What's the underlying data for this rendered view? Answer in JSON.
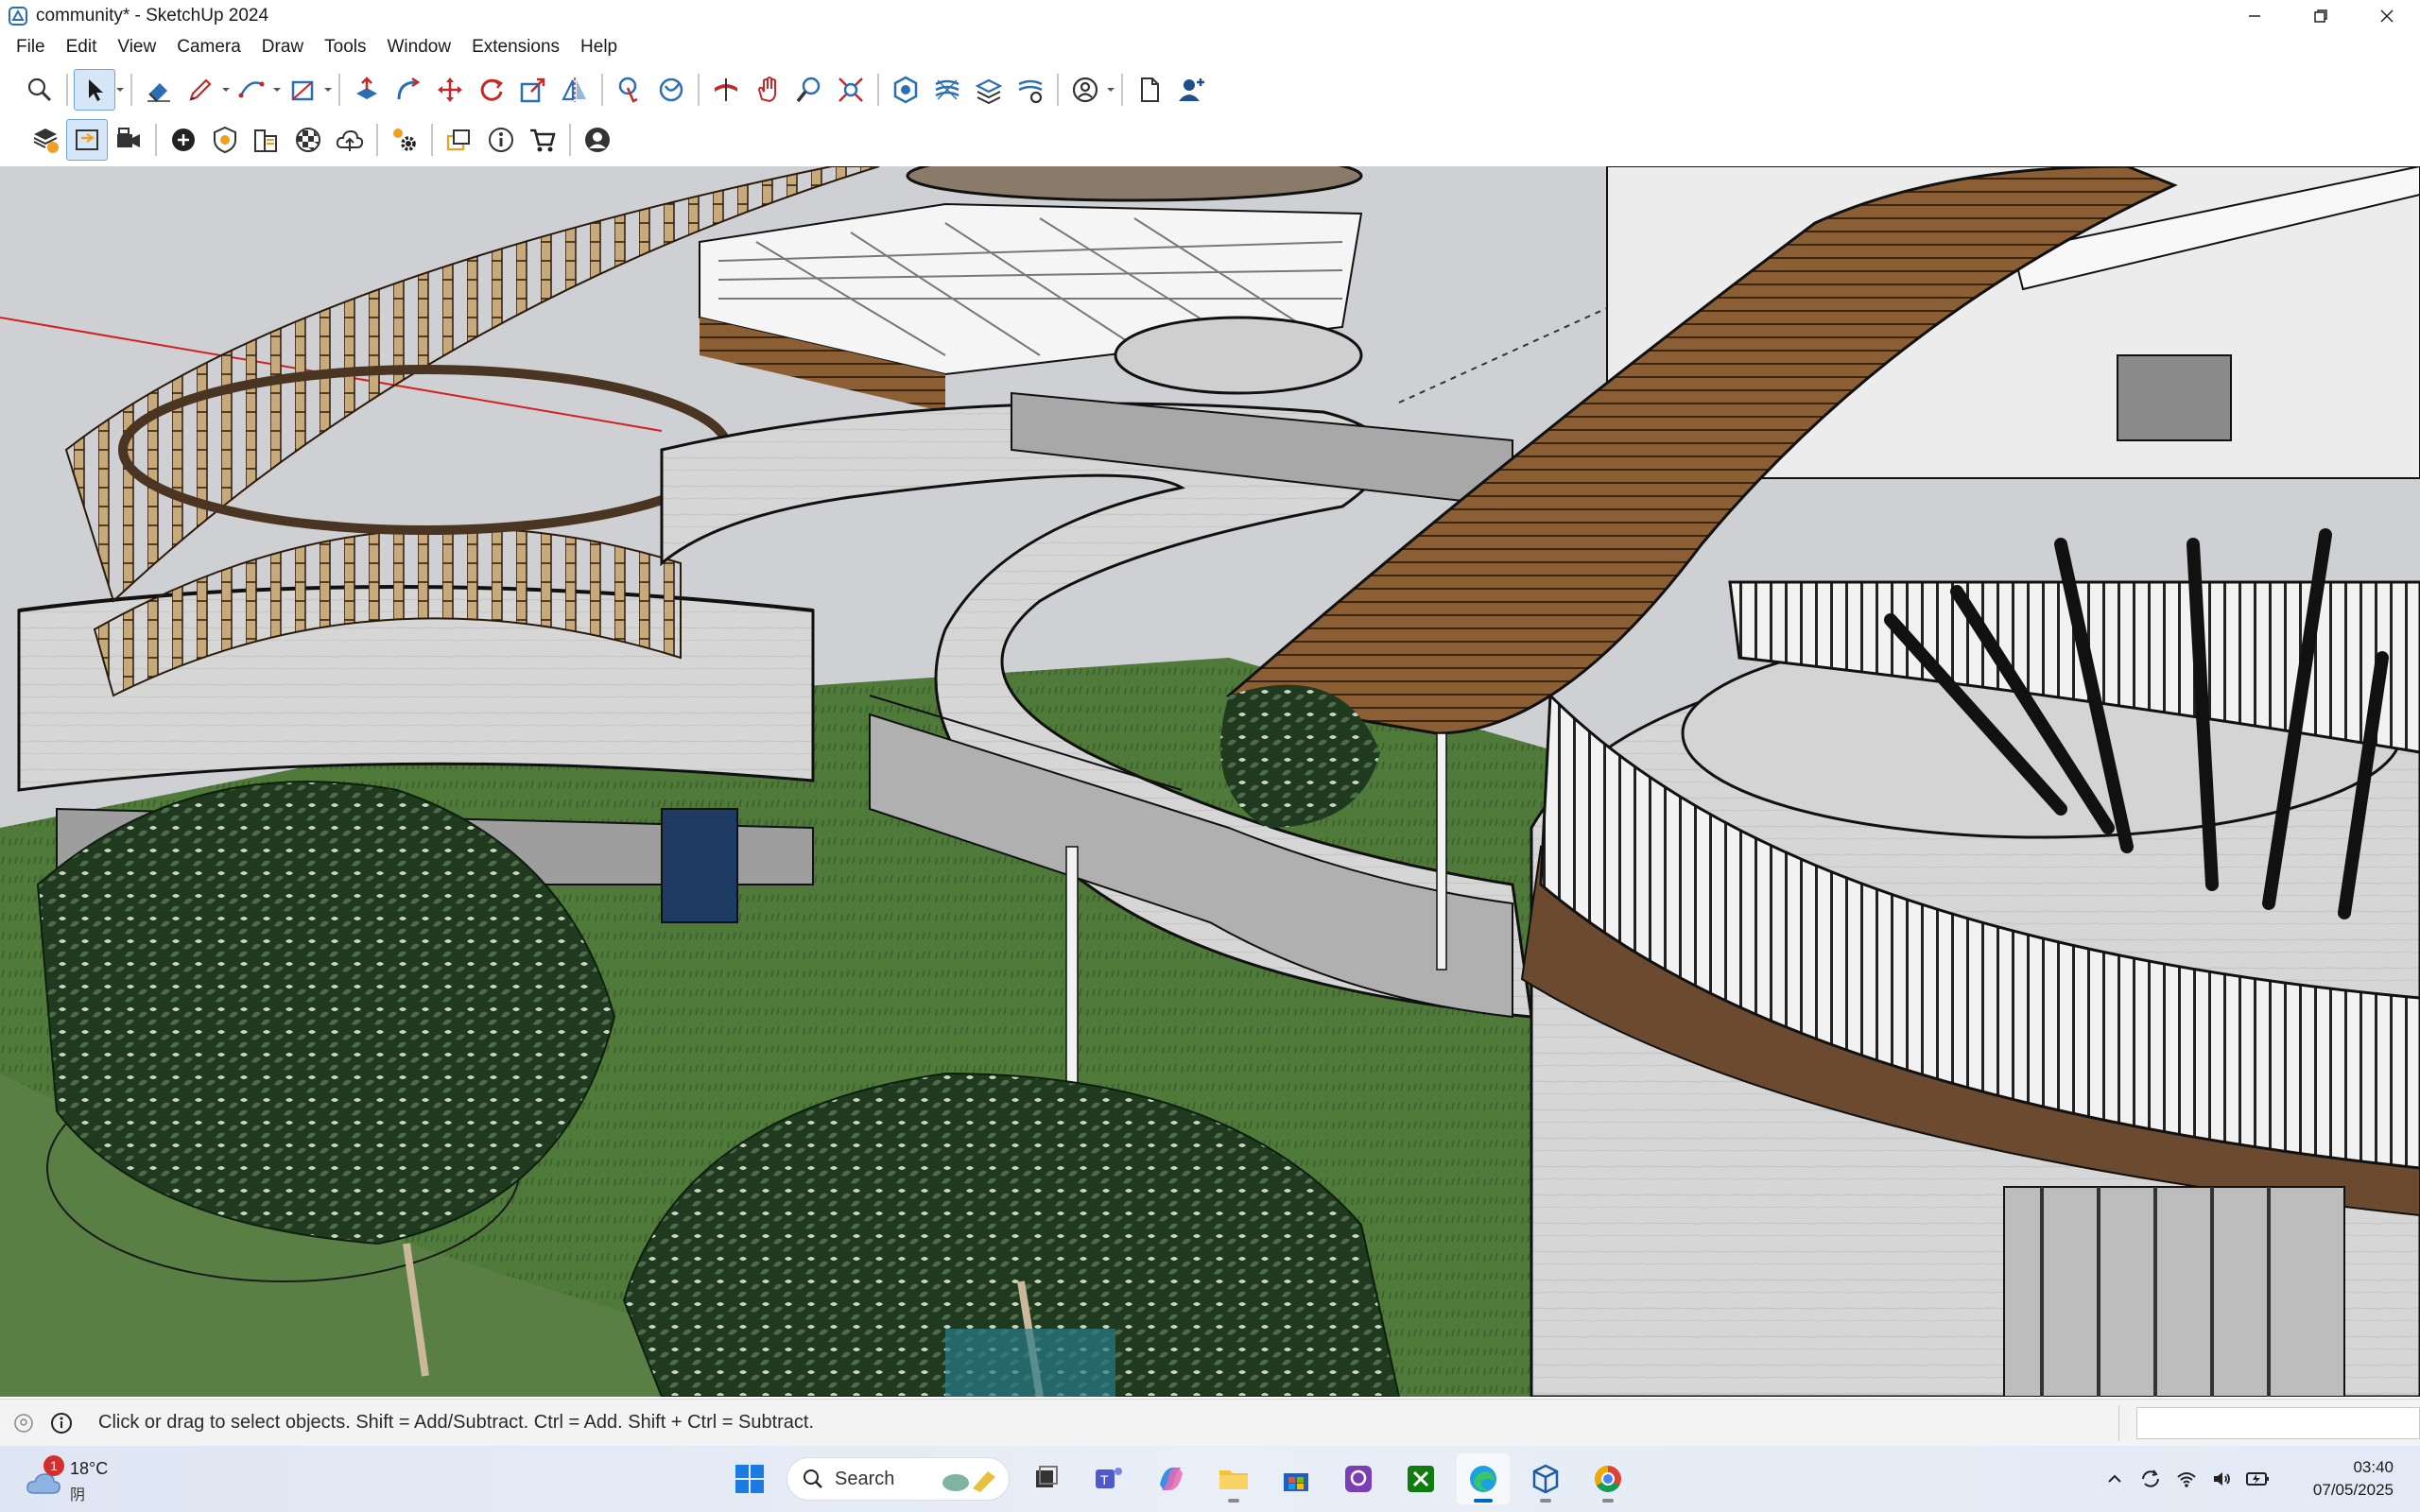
{
  "window": {
    "title": "community* - SketchUp 2024",
    "app_icon": "sketchup-icon",
    "controls": [
      "minimize-icon",
      "restore-icon",
      "close-icon"
    ]
  },
  "menu": {
    "items": [
      "File",
      "Edit",
      "View",
      "Camera",
      "Draw",
      "Tools",
      "Window",
      "Extensions",
      "Help"
    ]
  },
  "toolbar1": {
    "tools": [
      "zoom-extents",
      "select",
      "eraser",
      "pencil-line",
      "arc",
      "rectangle",
      "push-pull",
      "follow-me",
      "move",
      "rotate",
      "scale",
      "flip",
      "paint-bucket",
      "orbit-color",
      "section-plane",
      "pan",
      "zoom",
      "zoom-window",
      "solid-tools",
      "sandbox",
      "outliner",
      "tags",
      "account",
      "new-file",
      "add-user"
    ]
  },
  "toolbar2": {
    "tools": [
      "extension-warehouse",
      "scene-sync",
      "camera-scene",
      "add-location",
      "shadow",
      "styles",
      "materials",
      "cloud-upload",
      "settings",
      "scenes",
      "model-info",
      "shop",
      "user"
    ]
  },
  "status": {
    "message": "Click or drag to select objects. Shift = Add/Subtract. Ctrl = Add. Shift + Ctrl = Subtract.",
    "measurements_value": ""
  },
  "taskbar": {
    "weather": {
      "temp": "18°C",
      "condition": "阴",
      "badge": "1"
    },
    "search_label": "Search",
    "apps": [
      "windows-start",
      "search",
      "task-view",
      "teams",
      "copilot",
      "file-explorer",
      "ms-store",
      "app-purple",
      "xbox",
      "edge",
      "sketchup",
      "chrome"
    ],
    "clock": {
      "time": "03:40",
      "date": "07/05/2025"
    }
  },
  "colors": {
    "selection_blue": "#0067c0",
    "axis_red": "#d42020",
    "wood_dark": "#7a5230",
    "concrete": "#d9d9d9",
    "grass": "#4f7a3a"
  }
}
